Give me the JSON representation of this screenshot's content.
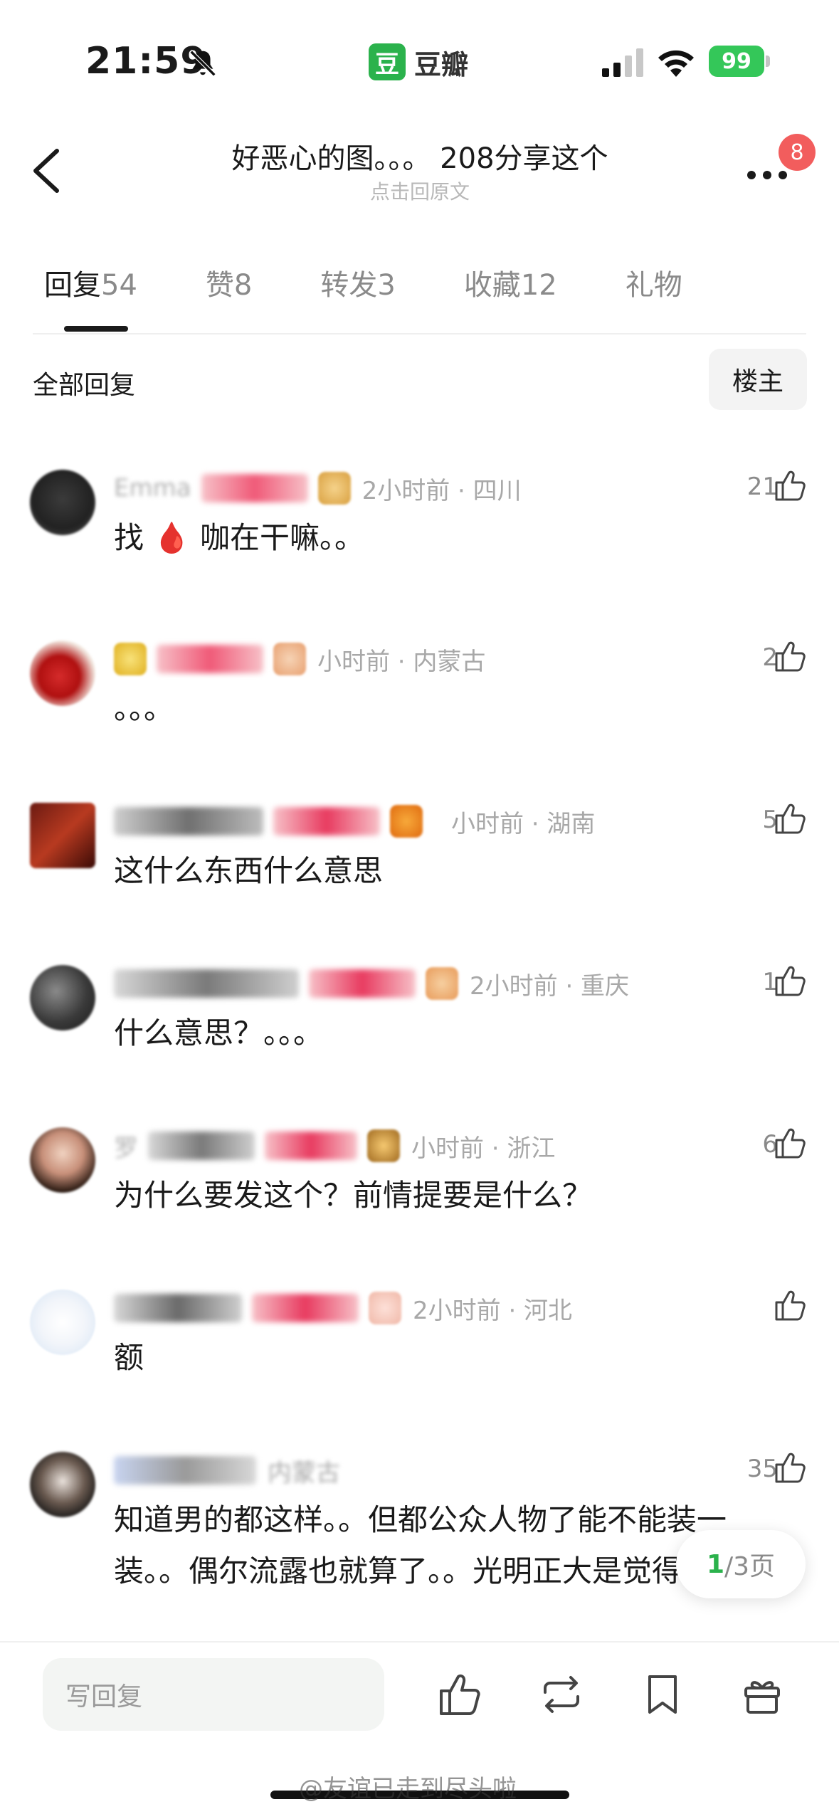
{
  "status_bar": {
    "time": "21:59",
    "app_logo": "豆",
    "app_name": "豆瓣",
    "battery": "99"
  },
  "nav": {
    "title": "好恶心的图。。。 208分享这个",
    "subtitle": "点击回原文",
    "more_badge": "8"
  },
  "tabs": [
    {
      "label": "回复",
      "count": "54",
      "active": true
    },
    {
      "label": "赞",
      "count": "8"
    },
    {
      "label": "转发",
      "count": "3"
    },
    {
      "label": "收藏",
      "count": "12"
    },
    {
      "label": "礼物",
      "count": ""
    }
  ],
  "filter": {
    "label": "全部回复",
    "button": "楼主"
  },
  "comments": [
    {
      "username": "Emma",
      "time_loc": "2小时前 · 四川",
      "likes": "21",
      "text": "找 🩸 咖在干嘛。。"
    },
    {
      "username": "",
      "time_loc": "小时前 · 内蒙古",
      "likes": "2",
      "text": "。。。"
    },
    {
      "username": "",
      "time_loc": "小时前 · 湖南",
      "likes": "5",
      "text": "这什么东西什么意思"
    },
    {
      "username": "",
      "time_loc": "2小时前 · 重庆",
      "likes": "1",
      "text": "什么意思？。。。"
    },
    {
      "username": "罗",
      "time_loc": "小时前 · 浙江",
      "likes": "6",
      "text": "为什么要发这个？前情提要是什么？"
    },
    {
      "username": "",
      "time_loc": "2小时前 · 河北",
      "likes": "",
      "text": "额"
    },
    {
      "username": "",
      "time_loc": "内蒙古",
      "likes": "35",
      "text": "知道男的都这样。。但都公众人物了能不能装一装。。偶尔流露也就算了。。光明正大是觉得谁爱看"
    }
  ],
  "pager": {
    "current": "1",
    "total": "/3页"
  },
  "bottom_bar": {
    "reply_placeholder": "写回复"
  },
  "watermark": "@友谊已走到尽头啦",
  "colors": {
    "accent": "#2bb24c",
    "badge": "#f25d5d",
    "battery": "#34c759"
  }
}
